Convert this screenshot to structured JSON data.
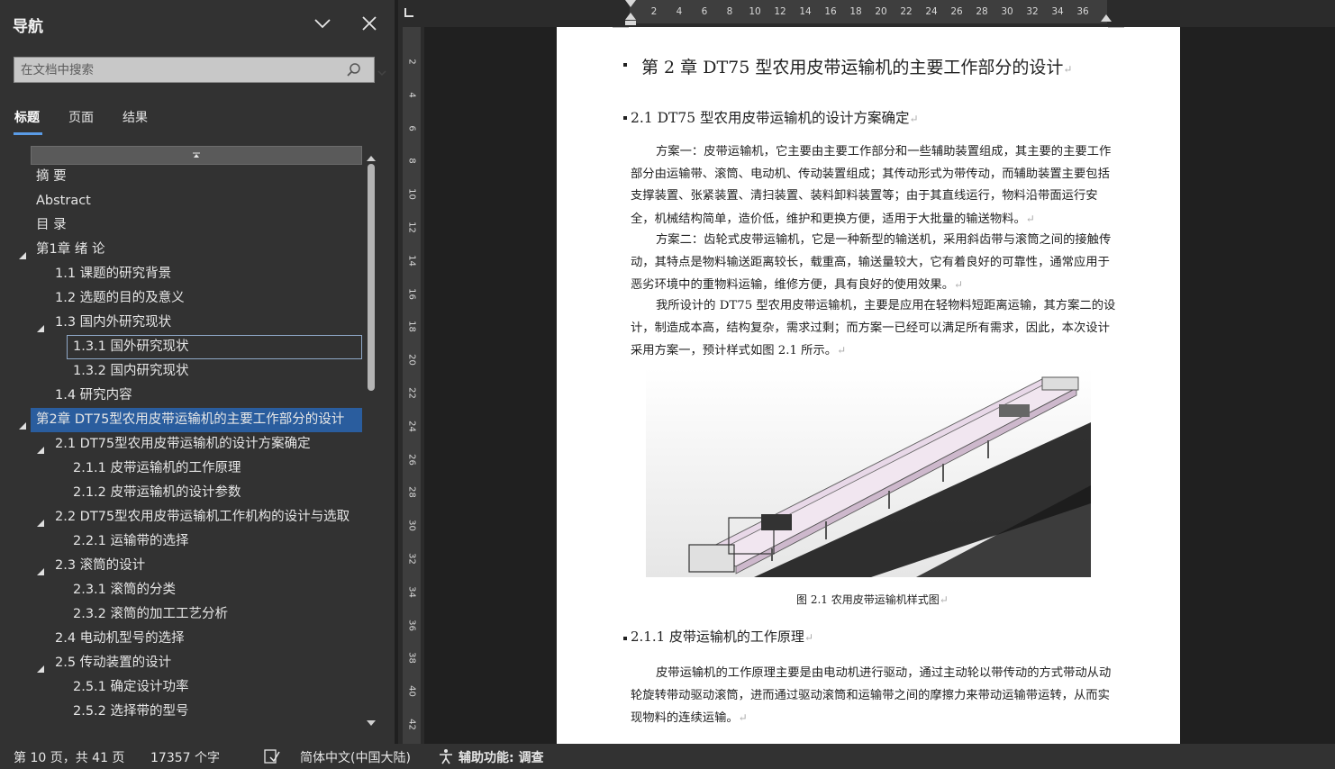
{
  "nav": {
    "title": "导航",
    "search_placeholder": "在文档中搜索",
    "tabs": [
      {
        "label": "标题",
        "active": true
      },
      {
        "label": "页面",
        "active": false
      },
      {
        "label": "结果",
        "active": false
      }
    ],
    "tree": [
      {
        "label": "摘  要",
        "level": 0,
        "toggle": false
      },
      {
        "label": "Abstract",
        "level": 0,
        "toggle": false
      },
      {
        "label": "目  录",
        "level": 0,
        "toggle": false
      },
      {
        "label": "第1章 绪  论",
        "level": 0,
        "toggle": true
      },
      {
        "label": "1.1 课题的研究背景",
        "level": 1,
        "toggle": false
      },
      {
        "label": "1.2 选题的目的及意义",
        "level": 1,
        "toggle": false
      },
      {
        "label": "1.3 国内外研究现状",
        "level": 1,
        "toggle": true
      },
      {
        "label": "1.3.1 国外研究现状",
        "level": 2,
        "toggle": false,
        "boxed": true
      },
      {
        "label": "1.3.2 国内研究现状",
        "level": 2,
        "toggle": false
      },
      {
        "label": "1.4 研究内容",
        "level": 1,
        "toggle": false
      },
      {
        "label": "第2章 DT75型农用皮带运输机的主要工作部分的设计",
        "level": 0,
        "toggle": true,
        "current": true
      },
      {
        "label": "2.1 DT75型农用皮带运输机的设计方案确定",
        "level": 1,
        "toggle": true
      },
      {
        "label": "2.1.1 皮带运输机的工作原理",
        "level": 2,
        "toggle": false
      },
      {
        "label": "2.1.2 皮带运输机的设计参数",
        "level": 2,
        "toggle": false
      },
      {
        "label": "2.2 DT75型农用皮带运输机工作机构的设计与选取",
        "level": 1,
        "toggle": true
      },
      {
        "label": "2.2.1 运输带的选择",
        "level": 2,
        "toggle": false
      },
      {
        "label": "2.3 滚筒的设计",
        "level": 1,
        "toggle": true
      },
      {
        "label": "2.3.1 滚筒的分类",
        "level": 2,
        "toggle": false
      },
      {
        "label": "2.3.2 滚筒的加工工艺分析",
        "level": 2,
        "toggle": false
      },
      {
        "label": "2.4 电动机型号的选择",
        "level": 1,
        "toggle": false
      },
      {
        "label": "2.5 传动装置的设计",
        "level": 1,
        "toggle": true
      },
      {
        "label": "2.5.1 确定设计功率",
        "level": 2,
        "toggle": false
      },
      {
        "label": "2.5.2 选择带的型号",
        "level": 2,
        "toggle": false
      }
    ]
  },
  "ruler": {
    "h_ticks": [
      "2",
      "4",
      "6",
      "8",
      "10",
      "12",
      "14",
      "16",
      "18",
      "20",
      "22",
      "24",
      "26",
      "28",
      "30",
      "32",
      "34",
      "36"
    ],
    "v_ticks": [
      "2",
      "4",
      "6",
      "8",
      "10",
      "12",
      "14",
      "16",
      "18",
      "20",
      "22",
      "24",
      "26",
      "28",
      "30",
      "32",
      "34",
      "36",
      "38",
      "40",
      "42"
    ]
  },
  "document": {
    "chapter_title": "第 2 章  DT75 型农用皮带运输机的主要工作部分的设计",
    "section_21": "2.1 DT75 型农用皮带运输机的设计方案确定",
    "para1": "方案一：皮带运输机，它主要由主要工作部分和一些辅助装置组成，其主要的主要工作部分由运输带、滚筒、电动机、传动装置组成；其传动形式为带传动，而辅助装置主要包括支撑装置、张紧装置、清扫装置、装料卸料装置等；由于其直线运行，物料沿带面运行安全，机械结构简单，造价低，维护和更换方便，适用于大批量的输送物料。",
    "para2": "方案二：齿轮式皮带运输机，它是一种新型的输送机，采用斜齿带与滚筒之间的接触传动，其特点是物料输送距离较长，载重高，输送量较大，它有着良好的可靠性，通常应用于恶劣环境中的重物料运输，维修方便，具有良好的使用效果。",
    "para3": "我所设计的 DT75 型农用皮带运输机，主要是应用在轻物料短距离运输，其方案二的设计，制造成本高，结构复杂，需求过剩；而方案一已经可以满足所有需求，因此，本次设计采用方案一，预计样式如图 2.1 所示。",
    "figure_caption": "图 2.1  农用皮带运输机样式图",
    "section_211": "2.1.1  皮带运输机的工作原理",
    "para4": "皮带运输机的工作原理主要是由电动机进行驱动，通过主动轮以带传动的方式带动从动轮旋转带动驱动滚筒，进而通过驱动滚筒和运输带之间的摩擦力来带动运输带运转，从而实现物料的连续运输。",
    "para_mark": "↵"
  },
  "status": {
    "page": "第 10 页，共 41 页",
    "words": "17357 个字",
    "language": "简体中文(中国大陆)",
    "accessibility": "辅助功能: 调查"
  },
  "colors": {
    "nav_bg": "#323232",
    "selected_bg": "#2a5d9e",
    "tab_underline": "#5a9be6",
    "page_bg": "#ffffff",
    "doc_bg": "#202020"
  }
}
